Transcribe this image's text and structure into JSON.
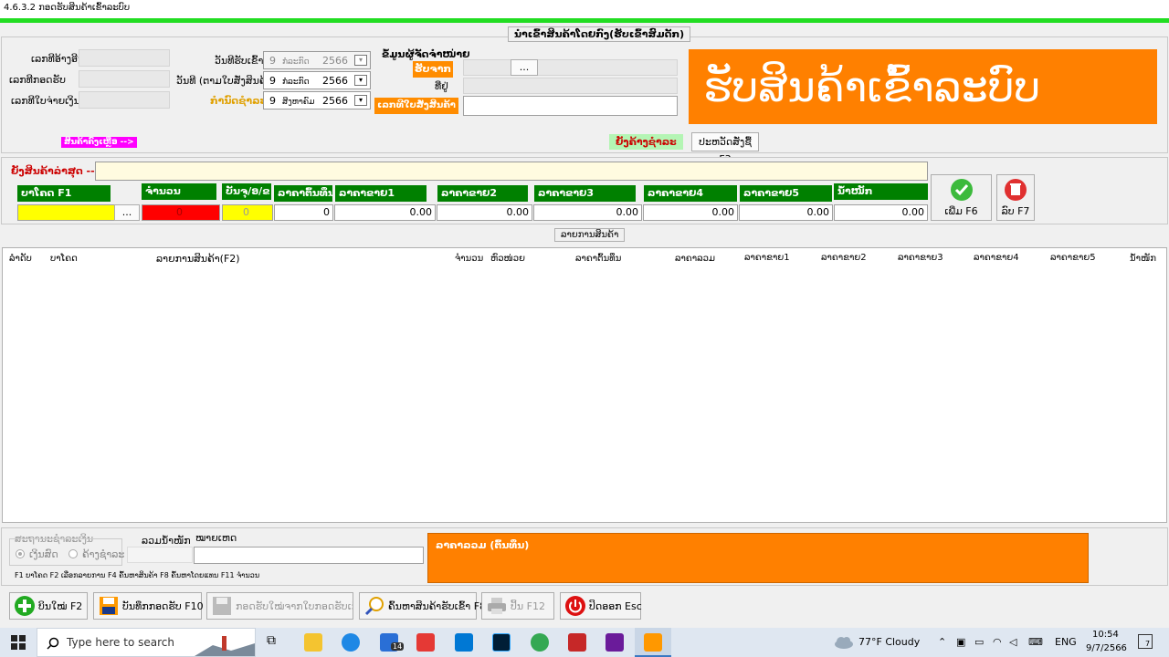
{
  "window": {
    "title": "4.6.3.2 ກອດຮັບສິນຄ້າເຂົ້າລະບົບ"
  },
  "header_group": {
    "title": "ນຳເຂົ້າສິນຄ້າໂດຍກົງ(ຮັບເຂົ້າສົມດັກ)"
  },
  "left_fields": {
    "ref_no": "ເລກທີອ້າງອີງ",
    "receive_no": "ເລກທີກອດຮັບ",
    "invoice_no": "ເລກທີໃບຈ່າຍເງິນ"
  },
  "dates": {
    "receive_date_label": "ວັນທີຮັບເຂົ້າ",
    "receive_date_day": "9",
    "receive_date_month": "ກໍລະກົດ",
    "receive_date_year": "2566",
    "invoice_date_label": "ວັນທີ (ຕາມໃບສັ່ງສິນຄ້າ)",
    "invoice_date_day": "9",
    "invoice_date_month": "ກໍລະກົດ",
    "invoice_date_year": "2566",
    "due_date_label": "ກຳນົດຊຳລະ",
    "due_date_day": "9",
    "due_date_month": "ສິງຫາຄົມ",
    "due_date_year": "2566"
  },
  "supplier": {
    "title": "ຂໍ້ມູນຜູ້ຈັດຈຳໜ່າຍ",
    "from_label": "ຮັບຈາກ",
    "browse_label": "...",
    "address_label": "ທີ່ຢູ່",
    "order_label": "ເລກທີໃບສັ່ງສິນຄ້າ"
  },
  "banner": {
    "text": "ຮັບສິນຄ້າເຂົ້າລະບົບ"
  },
  "links": {
    "remaining_items": "ສິນຄ້າຄົງເຫຼືອ -->",
    "unpaid": "ຍັງຄ້າງຊຳລະ",
    "history_button": "ປະຫວັດສັ່ງຊື້ F3"
  },
  "entry": {
    "last_item_label": "ຍັງສິນຄ້າລ່າສຸດ -->",
    "headers": [
      "ບາໂຄດ  F1",
      "ຈຳນວນ",
      "ບັນຈຸ/ອ/ຂ",
      "ລາຄາຕົ້ນທຶນ",
      "ລາຄາຂາຍ1",
      "ລາຄາຂາຍ2",
      "ລາຄາຂາຍ3",
      "ລາຄາຂາຍ4",
      "ລາຄາຂາຍ5",
      "ນ້ຳໜັກ"
    ],
    "barcode_browse": "...",
    "qty": "0",
    "pack": "0",
    "cost": "0",
    "price1": "0.00",
    "price2": "0.00",
    "price3": "0.00",
    "price4": "0.00",
    "price5": "0.00",
    "weight": "0.00",
    "add_button": "ເພີ່ມ F6",
    "delete_button": "ລົບ F7"
  },
  "items_group": {
    "title": "ລາຍການສິນຄ້າ"
  },
  "grid": {
    "columns": [
      "ລຳດັບ",
      "ບາໂຄດ",
      "ລາຍການສິນຄ້າ(F2)",
      "ຈຳນວນ",
      "ຫົວໜ່ວຍ",
      "ລາຄາຕົ້ນທຶນ",
      "ລາຄາລວມ",
      "ລາຄາຂາຍ1",
      "ລາຄາຂາຍ2",
      "ລາຄາຂາຍ3",
      "ລາຄາຂາຍ4",
      "ລາຄາຂາຍ5",
      "ນ້ຳໜັກ"
    ]
  },
  "payment": {
    "group_title": "ສະຖານະຊຳລະເງິນ",
    "cash_label": "ເງິນສົດ",
    "credit_label": "ຄ້າງຊຳລະ",
    "total_weight_label": "ລວມນ້ຳໜັກ",
    "note_label": "ໝາຍເຫດ",
    "shortcuts": "F1 ບາໂຄດ  F2 ເລືອກລາຍການ  F4 ຄົ້ນຫາສິນຄ້າ F8 ຄົ້ນຫາໂດຍແທນ  F11 ຈຳນວນ",
    "total_cost_label": "ລາຄາລວມ (ຕົ້ນທຶນ)"
  },
  "footer": {
    "new_bill": "ບິນໃໝ່  F2",
    "save": "ບັນທຶກກອດຮັບ F10",
    "save_from_order": "ກອດຮັບໃໝ່ຈາກໃບກອດຮັບເກົ່າ",
    "search_receipt": "ຄົ້ນຫາສິນຄ້າຮັບເຂົ້າ F8",
    "print": "ປິ້ນ F12",
    "close": "ປິດອອກ Esc"
  },
  "taskbar": {
    "search_placeholder": "Type here to search",
    "weather": "77°F  Cloudy",
    "lang": "ENG",
    "time": "10:54",
    "date": "9/7/2566",
    "mail_badge": "14",
    "notif_badge": "7"
  }
}
